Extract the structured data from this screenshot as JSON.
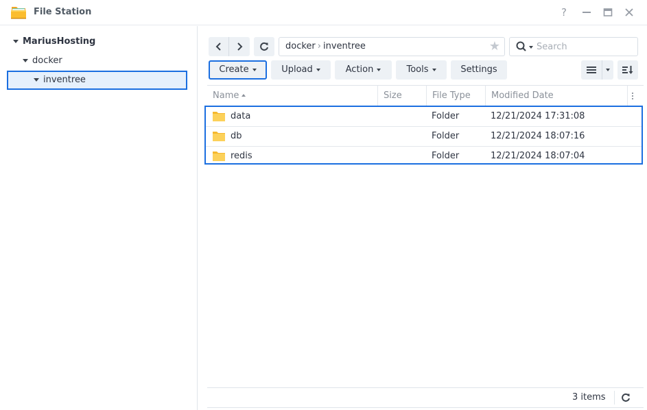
{
  "window": {
    "title": "File Station",
    "app_icon": "folder-icon",
    "controls": {
      "help": "?",
      "minimize": "minimize",
      "maximize": "maximize",
      "close": "close"
    }
  },
  "sidebar": {
    "tree": [
      {
        "label": "MariusHosting",
        "level": 0,
        "expanded": true
      },
      {
        "label": "docker",
        "level": 1,
        "expanded": true
      },
      {
        "label": "inventree",
        "level": 2,
        "expanded": true,
        "selected": true
      }
    ]
  },
  "navigation": {
    "back_icon": "chevron-left-icon",
    "forward_icon": "chevron-right-icon",
    "refresh_icon": "refresh-icon",
    "path": [
      "docker",
      "inventree"
    ],
    "path_separator": "›",
    "favorite_icon": "star-icon"
  },
  "search": {
    "placeholder": "Search",
    "value": ""
  },
  "toolbar": {
    "create_label": "Create",
    "upload_label": "Upload",
    "action_label": "Action",
    "tools_label": "Tools",
    "settings_label": "Settings",
    "view_icon": "list-view-icon",
    "sort_icon": "sort-icon"
  },
  "table": {
    "columns": [
      "Name",
      "Size",
      "File Type",
      "Modified Date"
    ],
    "sort_column": "Name",
    "sort_direction": "ascending",
    "rows": [
      {
        "name": "data",
        "size": "",
        "type": "Folder",
        "modified": "12/21/2024 17:31:08"
      },
      {
        "name": "db",
        "size": "",
        "type": "Folder",
        "modified": "12/21/2024 18:07:16"
      },
      {
        "name": "redis",
        "size": "",
        "type": "Folder",
        "modified": "12/21/2024 18:07:04"
      }
    ]
  },
  "footer": {
    "item_count": "3 items"
  },
  "colors": {
    "accent": "#1a6ee0",
    "selection_bg": "#e6f0fc",
    "button_bg": "#edf1f5",
    "folder_yellow": "#fbc94d"
  }
}
